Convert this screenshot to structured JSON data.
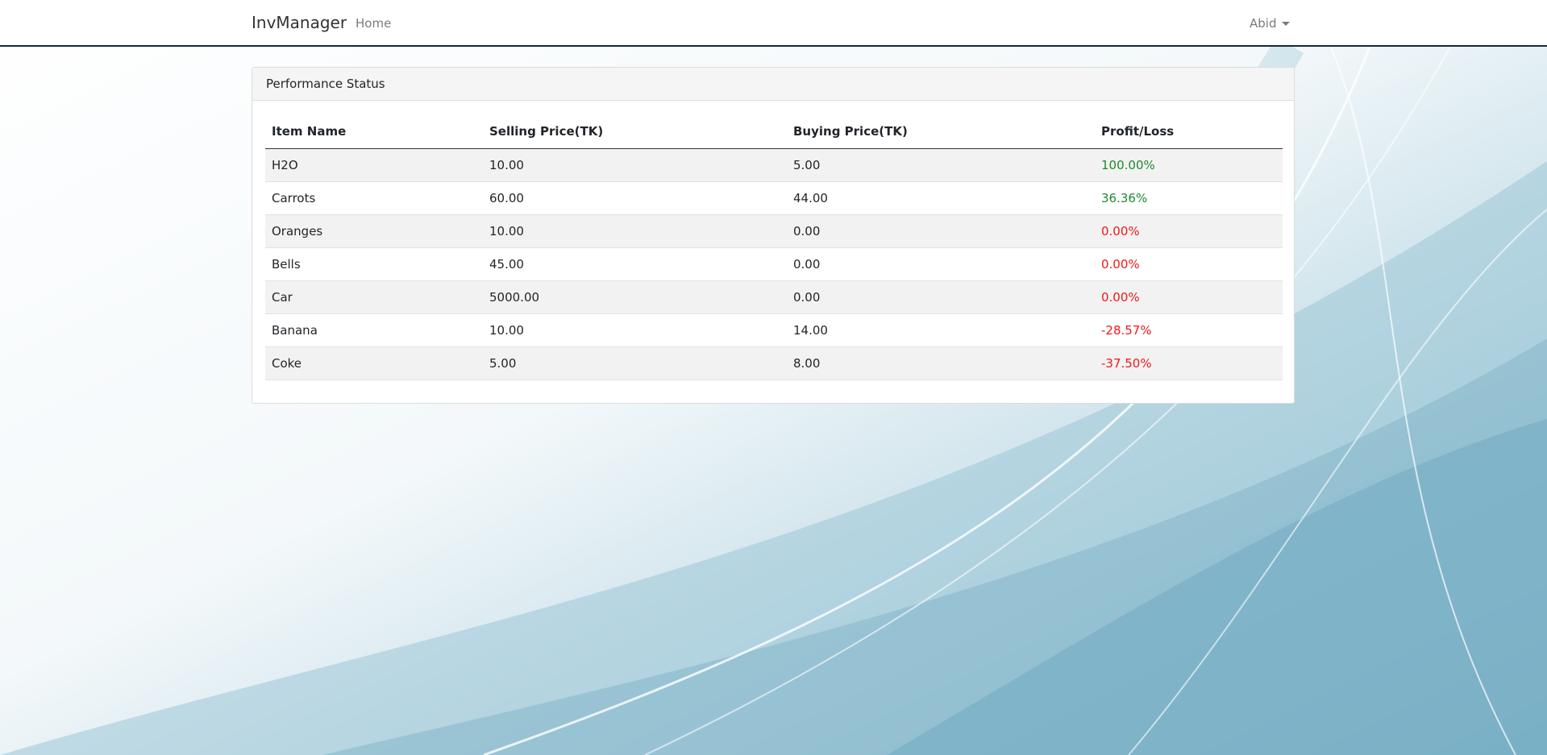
{
  "navbar": {
    "brand": "InvManager",
    "home_link": "Home",
    "user": "Abid"
  },
  "card": {
    "title": "Performance Status"
  },
  "table": {
    "headers": [
      "Item Name",
      "Selling Price(TK)",
      "Buying Price(TK)",
      "Profit/Loss"
    ],
    "rows": [
      {
        "item": "H2O",
        "selling": "10.00",
        "buying": "5.00",
        "profit": "100.00%",
        "status": "positive"
      },
      {
        "item": "Carrots",
        "selling": "60.00",
        "buying": "44.00",
        "profit": "36.36%",
        "status": "positive"
      },
      {
        "item": "Oranges",
        "selling": "10.00",
        "buying": "0.00",
        "profit": "0.00%",
        "status": "negative"
      },
      {
        "item": "Bells",
        "selling": "45.00",
        "buying": "0.00",
        "profit": "0.00%",
        "status": "negative"
      },
      {
        "item": "Car",
        "selling": "5000.00",
        "buying": "0.00",
        "profit": "0.00%",
        "status": "negative"
      },
      {
        "item": "Banana",
        "selling": "10.00",
        "buying": "14.00",
        "profit": "-28.57%",
        "status": "negative"
      },
      {
        "item": "Coke",
        "selling": "5.00",
        "buying": "8.00",
        "profit": "-37.50%",
        "status": "negative"
      }
    ]
  },
  "colors": {
    "positive": "#1e8a2e",
    "negative": "#f01818",
    "navbar_border": "#0f2a3d"
  },
  "icons": {
    "user_dropdown": "caret-down-icon"
  }
}
